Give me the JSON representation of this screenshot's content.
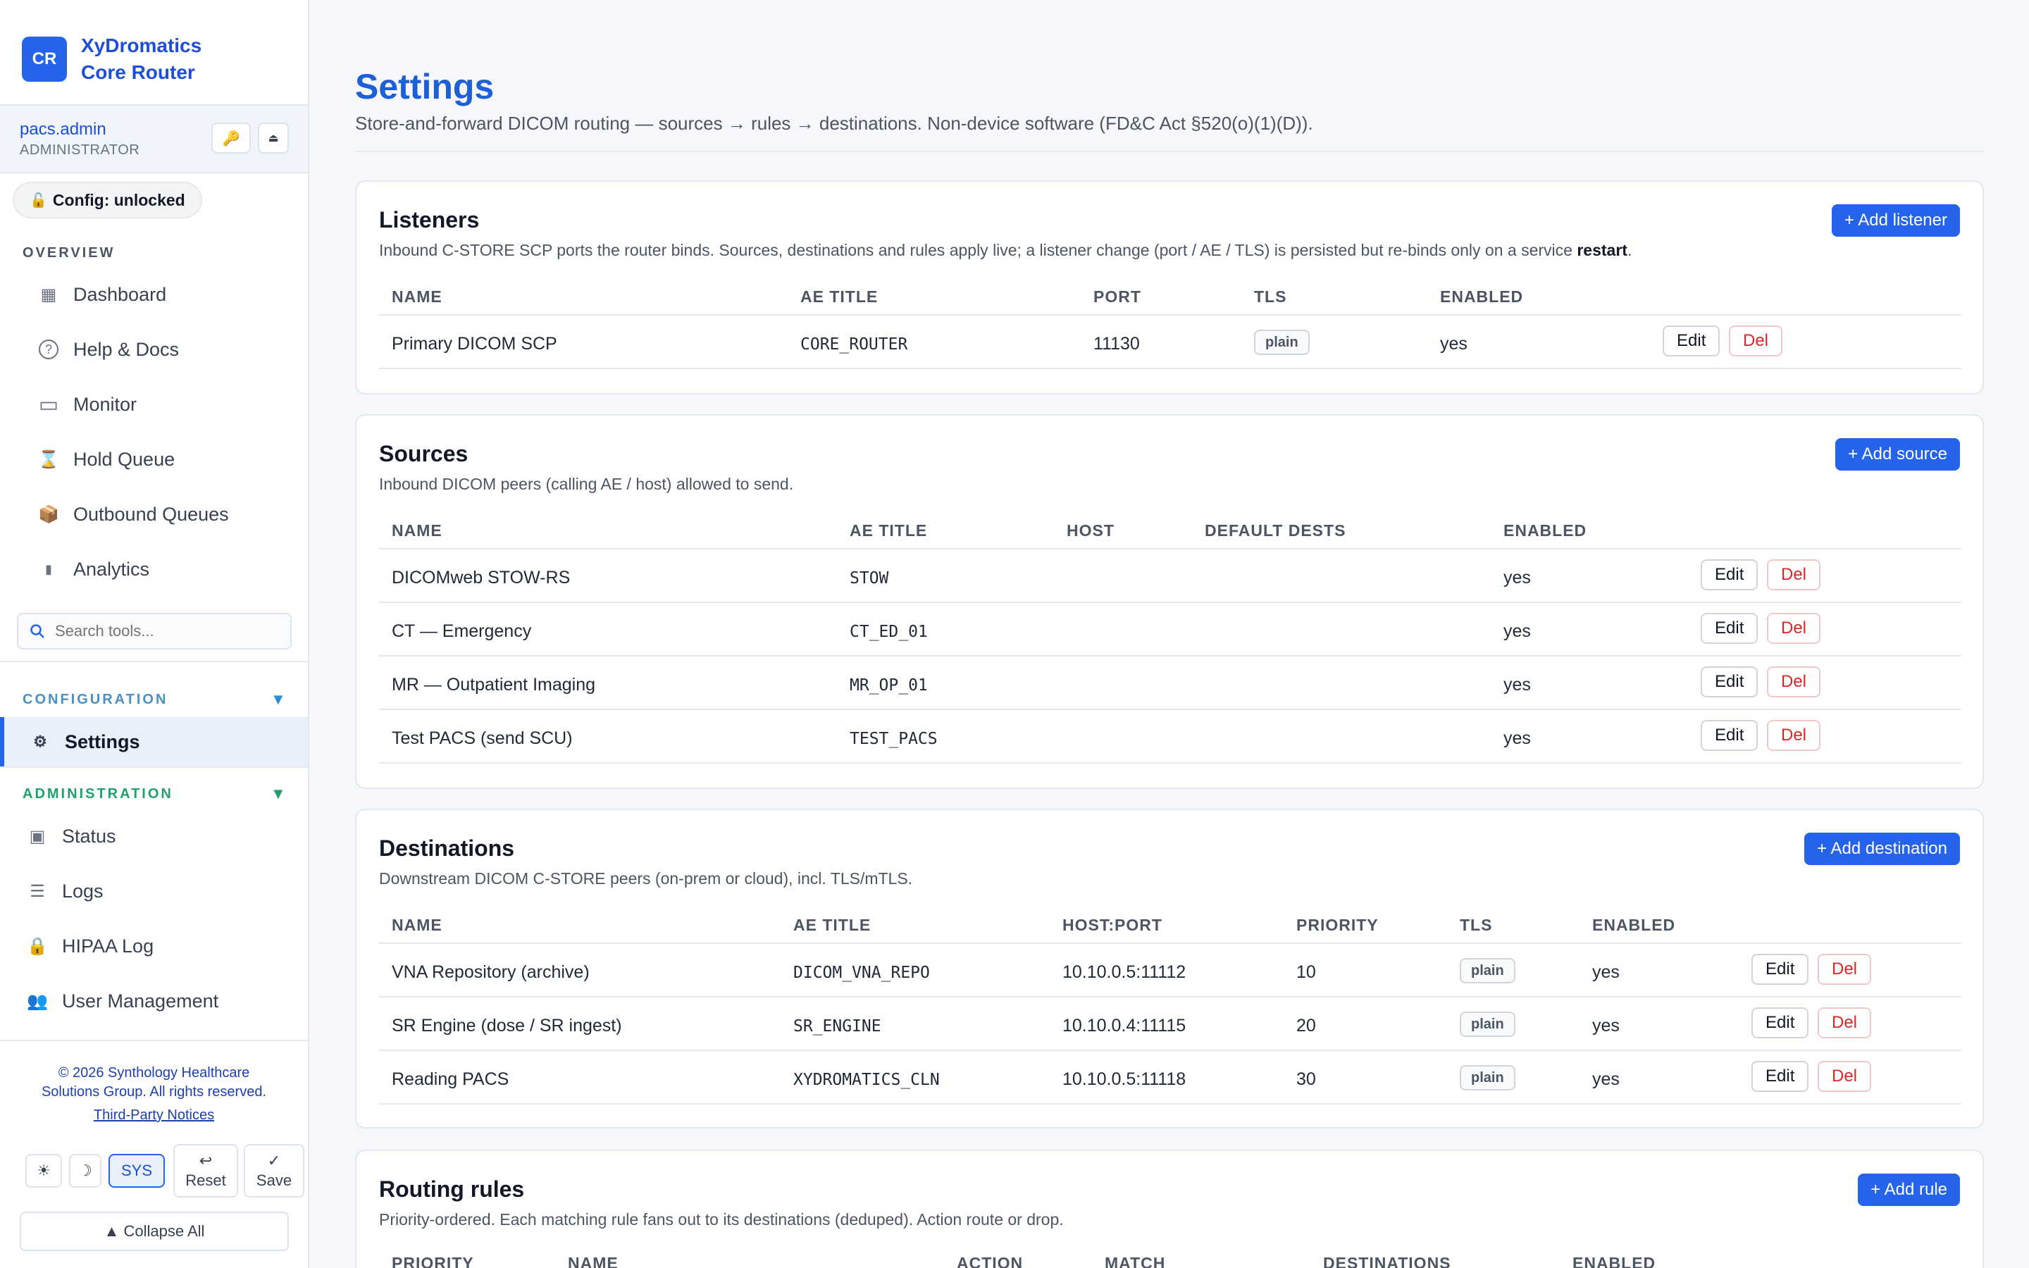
{
  "brand": {
    "logo": "CR",
    "name": "XyDromatics Core Router"
  },
  "user": {
    "name": "pacs.admin",
    "role": "ADMINISTRATOR",
    "key_icon": "🔑",
    "eject_icon": "⏏"
  },
  "config_status": {
    "icon": "🔓",
    "label": "Config: unlocked"
  },
  "nav": {
    "overview_label": "OVERVIEW",
    "overview": [
      {
        "label": "Dashboard",
        "icon": "▦"
      },
      {
        "label": "Help & Docs",
        "icon": "?"
      },
      {
        "label": "Monitor",
        "icon": "▭"
      },
      {
        "label": "Hold Queue",
        "icon": "⌛"
      },
      {
        "label": "Outbound Queues",
        "icon": "📦"
      },
      {
        "label": "Analytics",
        "icon": "▮"
      }
    ],
    "search_placeholder": "Search tools...",
    "configuration_label": "CONFIGURATION",
    "configuration": [
      {
        "label": "Settings",
        "icon": "⚙"
      }
    ],
    "administration_label": "ADMINISTRATION",
    "administration": [
      {
        "label": "Status",
        "icon": "▣"
      },
      {
        "label": "Logs",
        "icon": "☰"
      },
      {
        "label": "HIPAA Log",
        "icon": "🔒"
      },
      {
        "label": "User Management",
        "icon": "👥"
      }
    ]
  },
  "footer": {
    "copyright_line1": "© 2026 Synthology Healthcare",
    "copyright_line2": "Solutions Group. All rights reserved.",
    "link": "Third-Party Notices",
    "theme_light": "☀",
    "theme_dark": "☽",
    "theme_sys": "SYS",
    "reset_icon": "↩",
    "reset_label": "Reset",
    "save_icon": "✓",
    "save_label": "Save",
    "collapse_label": "▲ Collapse All"
  },
  "page": {
    "title": "Settings",
    "subtitle": "Store-and-forward DICOM routing — sources → rules → destinations. Non-device software (FD&C Act §520(o)(1)(D))."
  },
  "listeners": {
    "title": "Listeners",
    "desc_pre": "Inbound C-STORE SCP ports the router binds. Sources, destinations and rules apply live; a listener change (port / AE / TLS) is persisted but re-binds only on a service ",
    "desc_bold": "restart",
    "desc_post": ".",
    "add": "+ Add listener",
    "headers": [
      "NAME",
      "AE TITLE",
      "PORT",
      "TLS",
      "ENABLED"
    ],
    "rows": [
      {
        "name": "Primary DICOM SCP",
        "ae": "CORE_ROUTER",
        "port": "11130",
        "tls": "plain",
        "enabled": "yes"
      }
    ]
  },
  "sources": {
    "title": "Sources",
    "desc": "Inbound DICOM peers (calling AE / host) allowed to send.",
    "add": "+ Add source",
    "headers": [
      "NAME",
      "AE TITLE",
      "HOST",
      "DEFAULT DESTS",
      "ENABLED"
    ],
    "rows": [
      {
        "name": "DICOMweb STOW-RS",
        "ae": "STOW",
        "enabled": "yes"
      },
      {
        "name": "CT — Emergency",
        "ae": "CT_ED_01",
        "enabled": "yes"
      },
      {
        "name": "MR — Outpatient Imaging",
        "ae": "MR_OP_01",
        "enabled": "yes"
      },
      {
        "name": "Test PACS (send SCU)",
        "ae": "TEST_PACS",
        "enabled": "yes"
      }
    ]
  },
  "destinations": {
    "title": "Destinations",
    "desc": "Downstream DICOM C-STORE peers (on-prem or cloud), incl. TLS/mTLS.",
    "add": "+ Add destination",
    "headers": [
      "NAME",
      "AE TITLE",
      "HOST:PORT",
      "PRIORITY",
      "TLS",
      "ENABLED"
    ],
    "rows": [
      {
        "name": "VNA Repository (archive)",
        "ae": "DICOM_VNA_REPO",
        "hostport": "10.10.0.5:11112",
        "priority": "10",
        "tls": "plain",
        "enabled": "yes"
      },
      {
        "name": "SR Engine (dose / SR ingest)",
        "ae": "SR_ENGINE",
        "hostport": "10.10.0.4:11115",
        "priority": "20",
        "tls": "plain",
        "enabled": "yes"
      },
      {
        "name": "Reading PACS",
        "ae": "XYDROMATICS_CLN",
        "hostport": "10.10.0.5:11118",
        "priority": "30",
        "tls": "plain",
        "enabled": "yes"
      }
    ]
  },
  "rules": {
    "title": "Routing rules",
    "desc": "Priority-ordered. Each matching rule fans out to its destinations (deduped). Action route or drop.",
    "add": "+ Add rule",
    "headers": [
      "PRIORITY",
      "NAME",
      "ACTION",
      "MATCH",
      "DESTINATIONS",
      "ENABLED"
    ]
  },
  "actions": {
    "edit": "Edit",
    "del": "Del"
  }
}
